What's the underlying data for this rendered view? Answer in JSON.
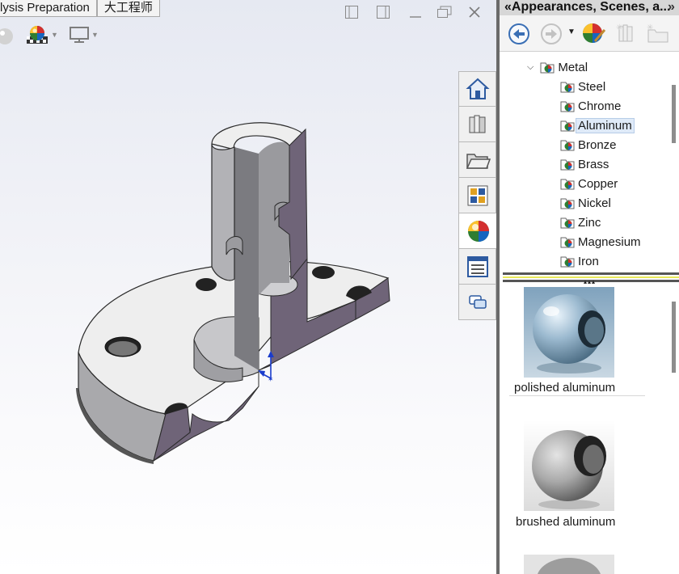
{
  "command_tabs": [
    "lysis Preparation",
    "大工程师"
  ],
  "panel": {
    "title": "«Appearances, Scenes, a...",
    "title_more": "»"
  },
  "tree": {
    "parent": "Metal",
    "items": [
      "Steel",
      "Chrome",
      "Aluminum",
      "Bronze",
      "Brass",
      "Copper",
      "Nickel",
      "Zinc",
      "Magnesium",
      "Iron"
    ],
    "selected": "Aluminum"
  },
  "thumbnails": [
    {
      "label": "polished aluminum"
    },
    {
      "label": "brushed aluminum"
    }
  ],
  "side_tabs": [
    "home-icon",
    "parts-library-icon",
    "folder-icon",
    "view-palette-icon",
    "appearances-icon",
    "custom-properties-icon",
    "forum-icon"
  ],
  "colors": {
    "panel_title_bg": "#d7d7d7",
    "selection_bg": "#dfeaf8",
    "sash_yellow": "#e9e95a",
    "section_face": "#6f6478",
    "model_face": "#eeeeee"
  }
}
